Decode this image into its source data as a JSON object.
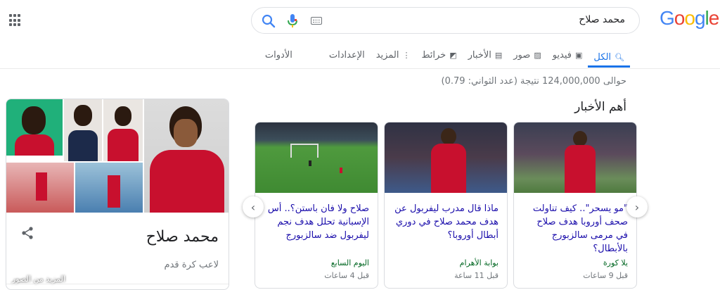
{
  "search": {
    "query": "محمد صلاح",
    "logo_text": "Google",
    "icons": [
      "search-icon",
      "mic-icon",
      "keyboard-icon",
      "apps-icon"
    ]
  },
  "tabs": [
    {
      "label": "الكل",
      "icon": "search-icon",
      "active": true
    },
    {
      "label": "فيديو",
      "icon": "video-icon"
    },
    {
      "label": "صور",
      "icon": "image-icon"
    },
    {
      "label": "الأخبار",
      "icon": "news-icon"
    },
    {
      "label": "خرائط",
      "icon": "map-icon"
    },
    {
      "label": "المزيد",
      "icon": "more-vert-icon"
    },
    {
      "label": "الإعدادات"
    },
    {
      "label": "الأدوات"
    }
  ],
  "results": {
    "stats": "حوالى 124,000,000 نتيجة (عدد الثواني: 0.79)",
    "news_heading": "أهم الأخبار"
  },
  "news": [
    {
      "headline": "\"مو يسحر\".. كيف تناولت صحف أوروبا هدف صلاح في مرمى سالزبورج بالأبطال؟",
      "source": "يلا كورة",
      "time": "قبل 9 ساعات"
    },
    {
      "headline": "ماذا قال مدرب ليفربول عن هدف محمد صلاح في دوري أبطال أوروبا؟",
      "source": "بوابة الأهرام",
      "time": "قبل 11 ساعة"
    },
    {
      "headline": "صلاح ولا فان باستن؟.. أس الإسبانية تحلل هدف نجم ليفربول ضد سالزبورج",
      "source": "اليوم السابع",
      "time": "قبل 4 ساعات"
    }
  ],
  "knowledge_panel": {
    "title": "محمد صلاح",
    "subtitle": "لاعب كرة قدم",
    "more_images": "المزيد من الصور"
  },
  "colors": {
    "link": "#1a0dab",
    "accent": "#1a73e8",
    "source_green": "#006621",
    "liverpool_red": "#c8102e"
  }
}
